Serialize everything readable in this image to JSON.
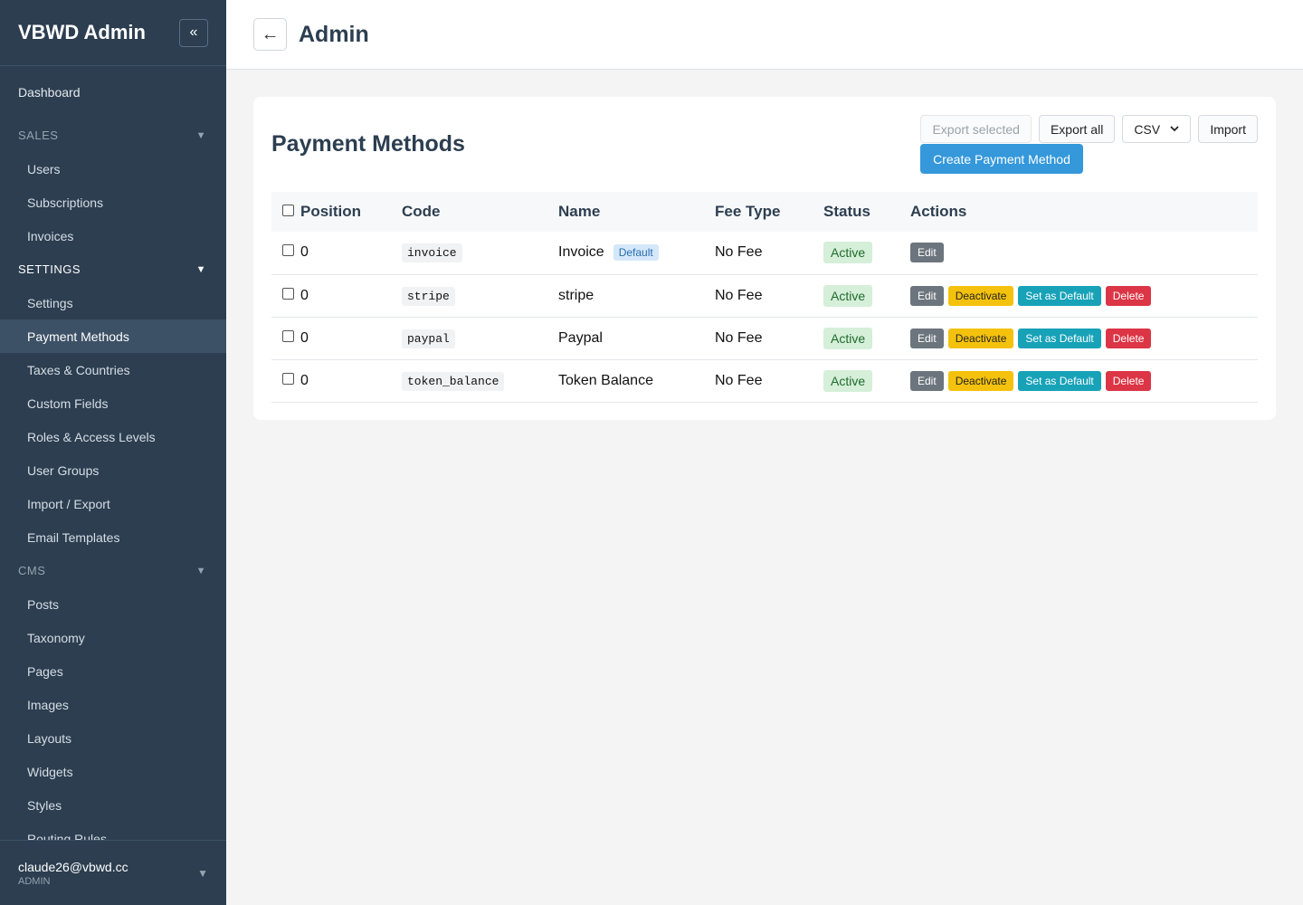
{
  "sidebar": {
    "brand": "VBWD Admin",
    "collapse_icon": "«",
    "dashboard": "Dashboard",
    "sections": [
      {
        "label": "SALES",
        "items": [
          "Users",
          "Subscriptions",
          "Invoices"
        ]
      },
      {
        "label": "SETTINGS",
        "items": [
          "Settings",
          "Payment Methods",
          "Taxes & Countries",
          "Custom Fields",
          "Roles & Access Levels",
          "User Groups",
          "Import / Export",
          "Email Templates"
        ]
      },
      {
        "label": "CMS",
        "items": [
          "Posts",
          "Taxonomy",
          "Pages",
          "Images",
          "Layouts",
          "Widgets",
          "Styles",
          "Routing Rules"
        ]
      }
    ],
    "active_item": "Payment Methods",
    "user": {
      "email": "claude26@vbwd.cc",
      "role": "ADMIN"
    },
    "caret": "▼"
  },
  "topbar": {
    "back_icon": "←",
    "title": "Admin"
  },
  "card": {
    "title": "Payment Methods",
    "toolbar": {
      "export_selected": "Export selected",
      "export_all": "Export all",
      "format_selected": "CSV",
      "import": "Import",
      "create": "Create Payment Method"
    },
    "table": {
      "headers": [
        "Position",
        "Code",
        "Name",
        "Fee Type",
        "Status",
        "Actions"
      ],
      "rows": [
        {
          "position": "0",
          "code": "invoice",
          "name": "Invoice",
          "badge": "Default",
          "fee_type": "No Fee",
          "status": "Active",
          "actions": [
            "Edit"
          ]
        },
        {
          "position": "0",
          "code": "stripe",
          "name": "stripe",
          "badge": "",
          "fee_type": "No Fee",
          "status": "Active",
          "actions": [
            "Edit",
            "Deactivate",
            "Set as Default",
            "Delete"
          ]
        },
        {
          "position": "0",
          "code": "paypal",
          "name": "Paypal",
          "badge": "",
          "fee_type": "No Fee",
          "status": "Active",
          "actions": [
            "Edit",
            "Deactivate",
            "Set as Default",
            "Delete"
          ]
        },
        {
          "position": "0",
          "code": "token_balance",
          "name": "Token Balance",
          "badge": "",
          "fee_type": "No Fee",
          "status": "Active",
          "actions": [
            "Edit",
            "Deactivate",
            "Set as Default",
            "Delete"
          ]
        }
      ]
    }
  },
  "colors": {
    "sidebar_bg": "#2c3e50",
    "primary": "#3498db",
    "edit": "#6c757d",
    "deactivate": "#f4c20d",
    "set_default": "#17a2b8",
    "delete": "#dc3545",
    "active_badge_bg": "#d5efd9"
  }
}
